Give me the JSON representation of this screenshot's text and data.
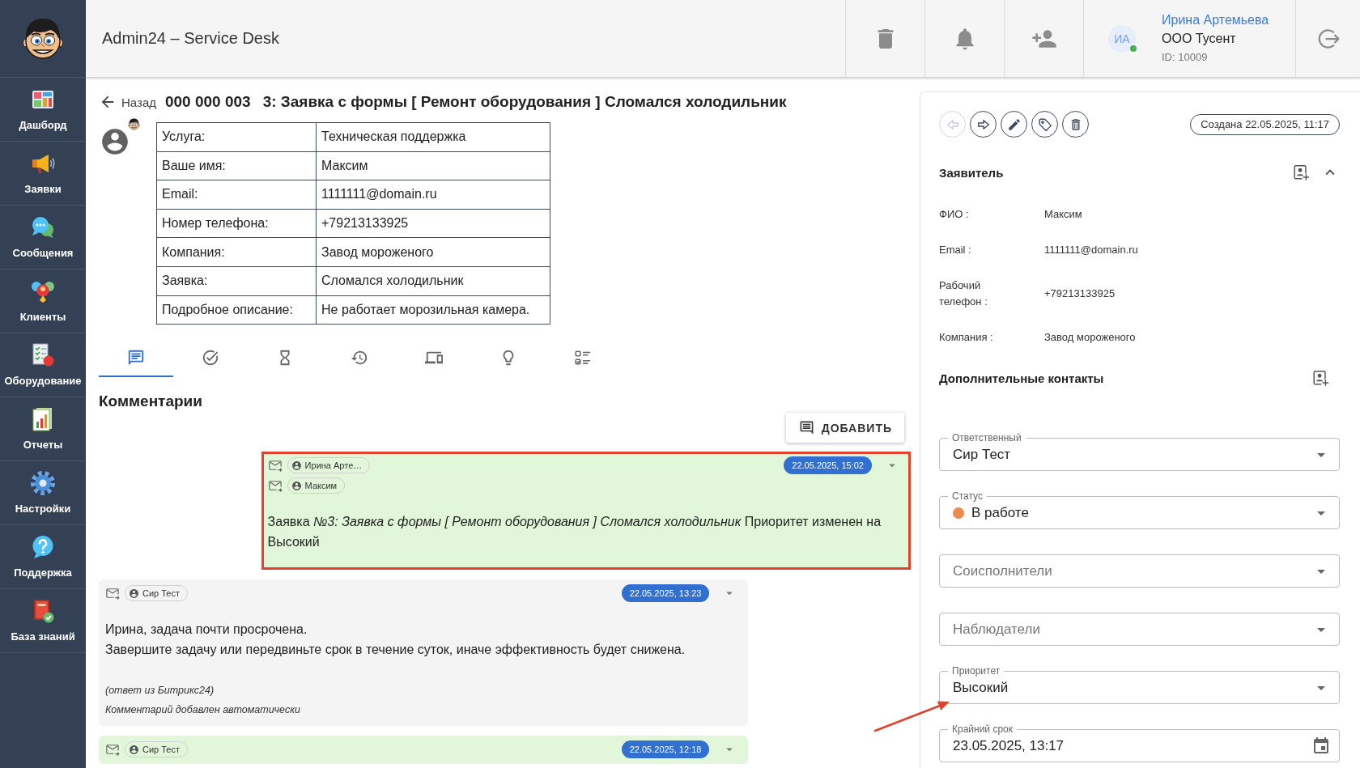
{
  "sidebar": {
    "items": [
      {
        "label": "Дашборд"
      },
      {
        "label": "Заявки"
      },
      {
        "label": "Сообщения"
      },
      {
        "label": "Клиенты"
      },
      {
        "label": "Оборудование"
      },
      {
        "label": "Отчеты"
      },
      {
        "label": "Настройки"
      },
      {
        "label": "Поддержка"
      },
      {
        "label": "База знаний"
      }
    ]
  },
  "header": {
    "title": "Admin24 – Service Desk",
    "user": {
      "initials": "ИА",
      "online": true,
      "name": "Ирина Артемьева",
      "company": "ООО Тусент",
      "id": "ID: 10009"
    }
  },
  "ticket": {
    "back": "Назад",
    "number": "000 000 003",
    "title": "3: Заявка с формы [ Ремонт оборудования ] Сломался холодильник",
    "form": [
      {
        "label": "Услуга:",
        "value": "Техническая поддержка"
      },
      {
        "label": "Ваше имя:",
        "value": "Максим"
      },
      {
        "label": "Email:",
        "value": "1111111@domain.ru"
      },
      {
        "label": "Номер телефона:",
        "value": "+79213133925"
      },
      {
        "label": "Компания:",
        "value": "Завод мороженого"
      },
      {
        "label": "Заявка:",
        "value": "Сломался холодильник"
      },
      {
        "label": "Подробное описание:",
        "value": "Не работает морозильная камера."
      }
    ]
  },
  "tabs": [
    {
      "selected": true
    },
    {
      "selected": false
    },
    {
      "selected": false
    },
    {
      "selected": false
    },
    {
      "selected": false
    },
    {
      "selected": false
    },
    {
      "selected": false
    }
  ],
  "comments": {
    "title": "Комментарии",
    "add_button": "ДОБАВИТЬ",
    "items": [
      {
        "outgoing": true,
        "highlighted": true,
        "color": "#e2f7d9",
        "recipients": [
          "Ирина Арте…",
          "Максим"
        ],
        "date": "22.05.2025, 15:02",
        "body": [
          "Заявка *№3: Заявка с формы [ Ремонт оборудования ] Сломался холодильник* Приоритет изменен на Высокий"
        ]
      },
      {
        "outgoing": false,
        "highlighted": false,
        "color": "#f4f4f4",
        "recipients": [
          "Сир Тест"
        ],
        "date": "22.05.2025, 13:23",
        "body": [
          "Ирина, задача почти просрочена.",
          "Завершите задачу или передвиньте срок в течение суток, иначе эффективность будет снижена."
        ],
        "notes": [
          "(ответ из Битрикс24)",
          "Комментарий добавлен автоматически"
        ]
      },
      {
        "outgoing": false,
        "highlighted": false,
        "color": "#e2f7d9",
        "recipients": [
          "Сир Тест"
        ],
        "date": "22.05.2025, 12:18"
      }
    ]
  },
  "panel": {
    "actions": [
      {
        "disabled": true
      },
      {
        "disabled": false
      },
      {
        "disabled": false
      },
      {
        "disabled": false
      },
      {
        "disabled": false
      }
    ],
    "created": "Создана 22.05.2025, 11:17",
    "applicant": {
      "title": "Заявитель",
      "expanded": true,
      "fields": [
        {
          "label": "ФИО :",
          "value": "Максим"
        },
        {
          "label": "Email :",
          "value": "1111111@domain.ru"
        },
        {
          "label": "Рабочий телефон :",
          "value": "+79213133925"
        },
        {
          "label": "Компания :",
          "value": "Завод мороженого"
        }
      ]
    },
    "extra_contacts": {
      "title": "Дополнительные контакты"
    },
    "fields": [
      {
        "kind": "select",
        "label": "Ответственный",
        "value": "Сир Тест"
      },
      {
        "kind": "select",
        "label": "Статус",
        "value": "В работе",
        "color": "#ef8a4f"
      },
      {
        "kind": "select",
        "placeholder": "Соисполнители"
      },
      {
        "kind": "select",
        "placeholder": "Наблюдатели"
      },
      {
        "kind": "select",
        "label": "Приоритет",
        "value": "Высокий"
      },
      {
        "kind": "date",
        "label": "Крайний срок",
        "value": "23.05.2025, 13:17"
      }
    ]
  }
}
